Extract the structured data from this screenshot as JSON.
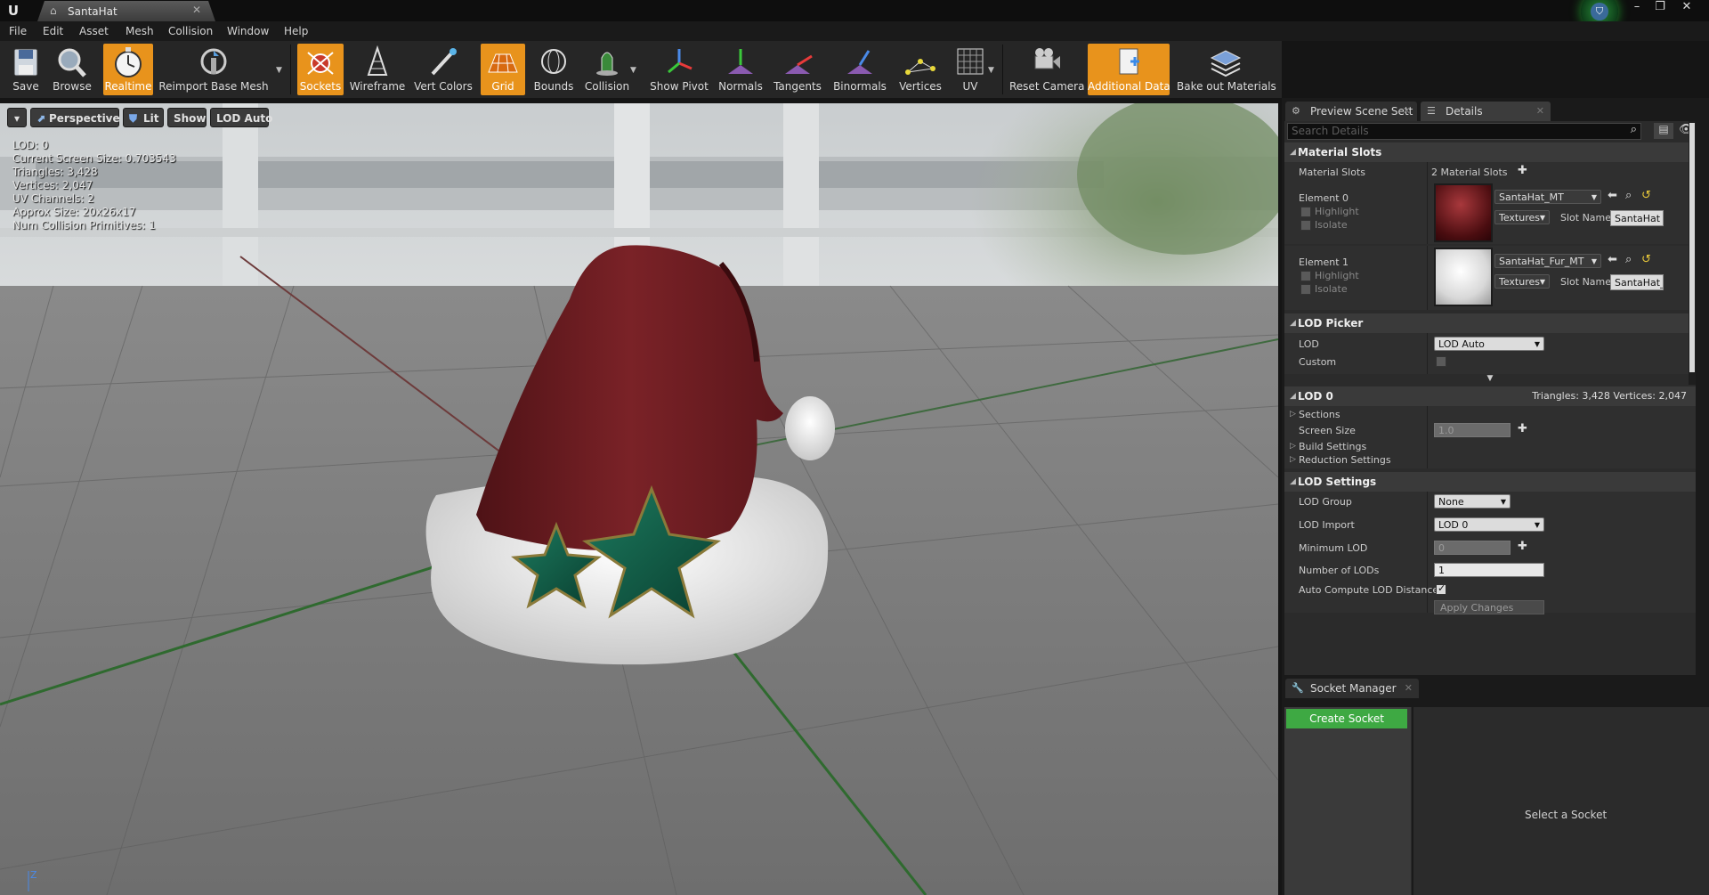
{
  "window": {
    "tab_title": "SantaHat",
    "controls": [
      "–",
      "❐",
      "✕"
    ]
  },
  "menu": [
    "File",
    "Edit",
    "Asset",
    "Mesh",
    "Collision",
    "Window",
    "Help"
  ],
  "toolbar": {
    "items": [
      {
        "label": "Save",
        "icon": "save-icon",
        "active": false
      },
      {
        "label": "Browse",
        "icon": "browse-icon",
        "active": false
      },
      {
        "label": "Realtime",
        "icon": "realtime-icon",
        "active": true
      },
      {
        "label": "Reimport Base Mesh",
        "icon": "reimport-icon",
        "active": false
      },
      {
        "label": "Sockets",
        "icon": "sockets-icon",
        "active": true
      },
      {
        "label": "Wireframe",
        "icon": "wireframe-icon",
        "active": false
      },
      {
        "label": "Vert Colors",
        "icon": "vert-colors-icon",
        "active": false
      },
      {
        "label": "Grid",
        "icon": "grid-icon",
        "active": true
      },
      {
        "label": "Bounds",
        "icon": "bounds-icon",
        "active": false
      },
      {
        "label": "Collision",
        "icon": "collision-icon",
        "active": false
      },
      {
        "label": "Show Pivot",
        "icon": "pivot-icon",
        "active": false
      },
      {
        "label": "Normals",
        "icon": "normals-icon",
        "active": false
      },
      {
        "label": "Tangents",
        "icon": "tangents-icon",
        "active": false
      },
      {
        "label": "Binormals",
        "icon": "binormals-icon",
        "active": false
      },
      {
        "label": "Vertices",
        "icon": "vertices-icon",
        "active": false
      },
      {
        "label": "UV",
        "icon": "uv-icon",
        "active": false
      },
      {
        "label": "Reset Camera",
        "icon": "reset-camera-icon",
        "active": false
      },
      {
        "label": "Additional Data",
        "icon": "additional-data-icon",
        "active": true
      },
      {
        "label": "Bake out Materials",
        "icon": "bake-materials-icon",
        "active": false
      }
    ]
  },
  "viewport": {
    "menu_arrow": "▾",
    "perspective": "Perspective",
    "lit": "Lit",
    "show": "Show",
    "lod": "LOD Auto",
    "stats": [
      "LOD:  0",
      "Current Screen Size:  0.703543",
      "Triangles:  3,428",
      "Vertices:  2,047",
      "UV Channels:  2",
      "Approx Size: 20x26x17",
      "Num Collision Primitives:  1"
    ],
    "axis_label": "Z"
  },
  "panel_tabs": {
    "preview": "Preview Scene Sett",
    "details": "Details",
    "socket_manager": "Socket Manager"
  },
  "details": {
    "search_placeholder": "Search Details",
    "material_slots": {
      "header": "Material Slots",
      "label": "Material Slots",
      "count": "2 Material Slots",
      "elements": [
        {
          "name": "Element 0",
          "highlight": "Highlight",
          "isolate": "Isolate",
          "material": "SantaHat_MT",
          "textures": "Textures",
          "slot_label": "Slot Name",
          "slot_value": "SantaHat"
        },
        {
          "name": "Element 1",
          "highlight": "Highlight",
          "isolate": "Isolate",
          "material": "SantaHat_Fur_MT",
          "textures": "Textures",
          "slot_label": "Slot Name",
          "slot_value": "SantaHat_"
        }
      ]
    },
    "lod_picker": {
      "header": "LOD Picker",
      "lod_label": "LOD",
      "lod_value": "LOD Auto",
      "custom_label": "Custom",
      "custom_checked": false
    },
    "lod0": {
      "header": "LOD 0",
      "summary": "Triangles: 3,428   Vertices: 2,047",
      "sections": "Sections",
      "screen_size_label": "Screen Size",
      "screen_size_value": "1.0",
      "build_settings": "Build Settings",
      "reduction_settings": "Reduction Settings"
    },
    "lod_settings": {
      "header": "LOD Settings",
      "lod_group_label": "LOD Group",
      "lod_group_value": "None",
      "lod_import_label": "LOD Import",
      "lod_import_value": "LOD 0",
      "min_lod_label": "Minimum LOD",
      "min_lod_value": "0",
      "num_lods_label": "Number of LODs",
      "num_lods_value": "1",
      "auto_compute_label": "Auto Compute LOD Distance",
      "auto_compute_checked": true,
      "apply_changes": "Apply Changes"
    }
  },
  "socket_manager": {
    "create_button": "Create Socket",
    "empty_text": "Select a Socket"
  },
  "colors": {
    "accent_orange": "#e8931c",
    "create_green": "#3ea943",
    "hat_red": "#6a1a1e",
    "star_green": "#0f5a45"
  }
}
